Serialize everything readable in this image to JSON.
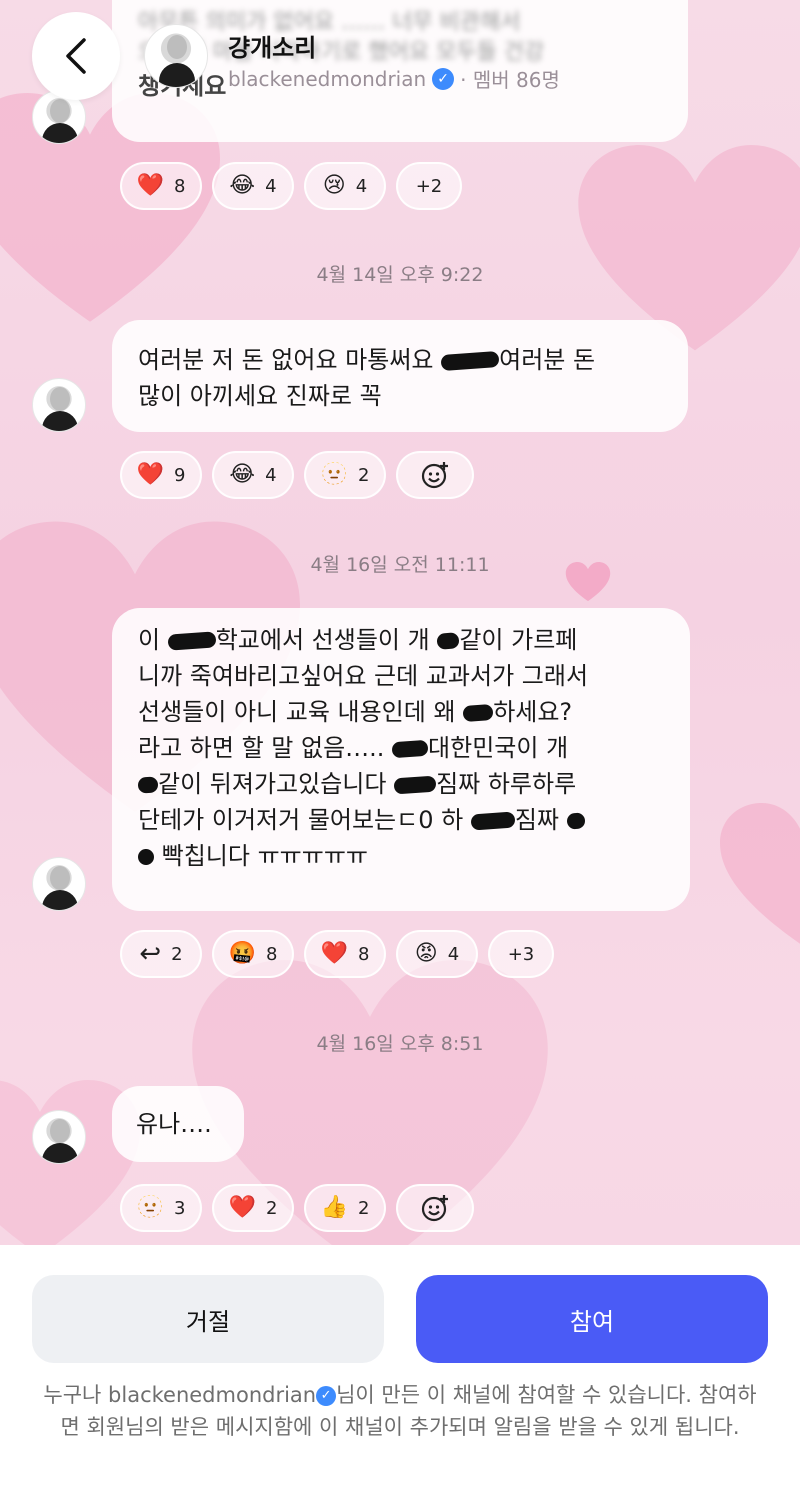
{
  "header": {
    "back_label": "<",
    "channel_title": "걍개소리",
    "channel_owner": "blackenedmondrian",
    "member_text": "· 멤버 86명"
  },
  "partial_message": {
    "blurred_line1": "아무튼 의미가 없어요 …… 너무 비관해서",
    "blurred_line2": "오늘 사 마을 시작하기로 했어요 모두들 건강",
    "last_line": "챙기세요"
  },
  "reactions_1": [
    {
      "icon": "❤️",
      "count": "8",
      "name": "heart"
    },
    {
      "icon": "😂",
      "count": "4",
      "name": "joy"
    },
    {
      "icon": "😢",
      "count": "4",
      "name": "cry"
    },
    {
      "icon": "",
      "count": "+2",
      "name": "more"
    }
  ],
  "timestamp_1": "4월 14일 오후 9:22",
  "message_2": {
    "line1_a": "여러분 저 돈 없어요 마통써요 ",
    "line1_b": "여러분 돈",
    "line2": "많이 아끼세요 진짜로 꼭"
  },
  "reactions_2": [
    {
      "icon": "❤️",
      "count": "9",
      "name": "heart"
    },
    {
      "icon": "😂",
      "count": "4",
      "name": "joy"
    },
    {
      "icon": "🫥",
      "count": "2",
      "name": "face"
    }
  ],
  "timestamp_2": "4월 16일 오전 11:11",
  "message_3": {
    "l1_a": "이 ",
    "l1_b": "학교에서 선생들이 개 ",
    "l1_c": "같이 가르페",
    "l2": "니까 죽여바리고싶어요 근데 교과서가 그래서",
    "l3_a": "선생들이 아니 교육 내용인데 왜 ",
    "l3_b": "하세요?",
    "l4_a": "라고 하면 할 말 없음….. ",
    "l4_b": "대한민국이 개",
    "l5_a": "같이 뒤져가고있습니다 ",
    "l5_b": "짐짜 하루하루",
    "l6_a": "단테가 이거저거 물어보는ㄷ0 하 ",
    "l6_b": "짐짜 ",
    "l7": "빡칩니다 ㅠㅠㅠㅠㅠ"
  },
  "reactions_3": [
    {
      "icon": "↩",
      "count": "2",
      "name": "reply"
    },
    {
      "icon": "🤬",
      "count": "8",
      "name": "cursing"
    },
    {
      "icon": "❤️",
      "count": "8",
      "name": "heart"
    },
    {
      "icon": "😡",
      "count": "4",
      "name": "angry"
    },
    {
      "icon": "",
      "count": "+3",
      "name": "more"
    }
  ],
  "timestamp_3": "4월 16일 오후 8:51",
  "message_4": {
    "text": "유나…."
  },
  "reactions_4": [
    {
      "icon": "🫥",
      "count": "3",
      "name": "face"
    },
    {
      "icon": "❤️",
      "count": "2",
      "name": "heart"
    },
    {
      "icon": "👍",
      "count": "2",
      "name": "thumbs-up"
    }
  ],
  "buttons": {
    "decline": "거절",
    "join": "참여"
  },
  "footer": {
    "pre": "누구나 blackenedmondrian",
    "post": "님이 만든 이 채널에 참여할 수 있습니다. 참여하면 회원님의 받은 메시지함에 이 채널이 추가되며 알림을 받을 수 있게 됩니다."
  },
  "colors": {
    "accent": "#4a5bf6",
    "verified": "#3d8bfd",
    "background": "#f6d4e3"
  }
}
